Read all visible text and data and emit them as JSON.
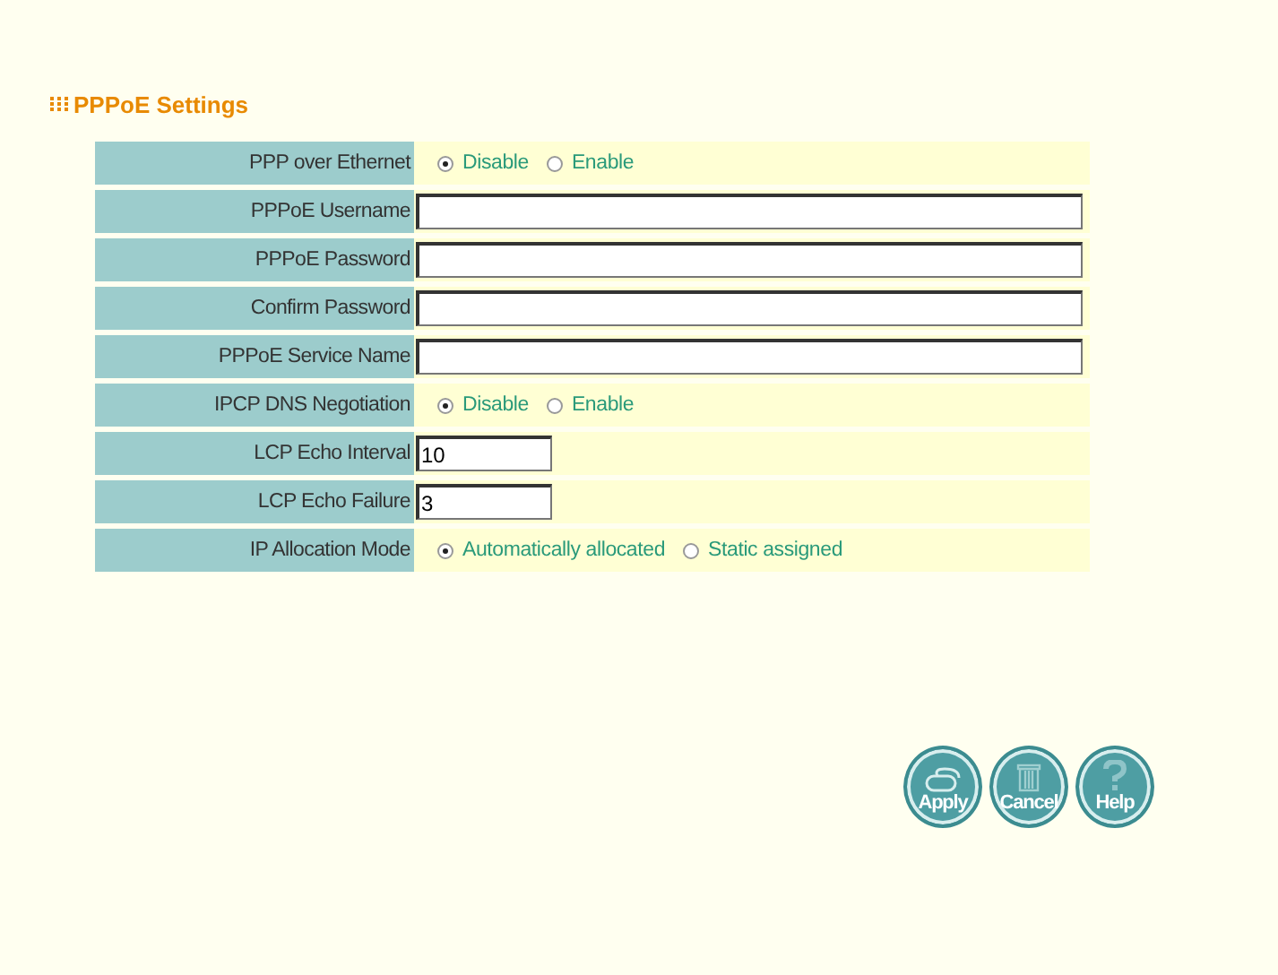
{
  "title": "PPPoE Settings",
  "fields": [
    {
      "kind": "radio",
      "label": "PPP over Ethernet",
      "options": [
        {
          "label": "Disable",
          "selected": true
        },
        {
          "label": "Enable",
          "selected": false
        }
      ]
    },
    {
      "kind": "text",
      "label": "PPPoE Username"
    },
    {
      "kind": "text",
      "label": "PPPoE Password"
    },
    {
      "kind": "text",
      "label": "Confirm Password"
    },
    {
      "kind": "text",
      "label": "PPPoE Service Name"
    },
    {
      "kind": "radio",
      "label": "IPCP DNS Negotiation",
      "options": [
        {
          "label": "Disable",
          "selected": true
        },
        {
          "label": "Enable",
          "selected": false
        }
      ]
    },
    {
      "kind": "short",
      "label": "LCP Echo Interval",
      "value": "10"
    },
    {
      "kind": "short",
      "label": "LCP Echo Failure",
      "value": "3"
    },
    {
      "kind": "radio",
      "label": "IP Allocation Mode",
      "options": [
        {
          "label": "Automatically allocated",
          "selected": true
        },
        {
          "label": "Static assigned",
          "selected": false
        }
      ]
    }
  ],
  "buttons": [
    {
      "label": "Apply",
      "kind": "apply"
    },
    {
      "label": "Cancel",
      "kind": "cancel"
    },
    {
      "label": "Help",
      "kind": "help"
    }
  ]
}
